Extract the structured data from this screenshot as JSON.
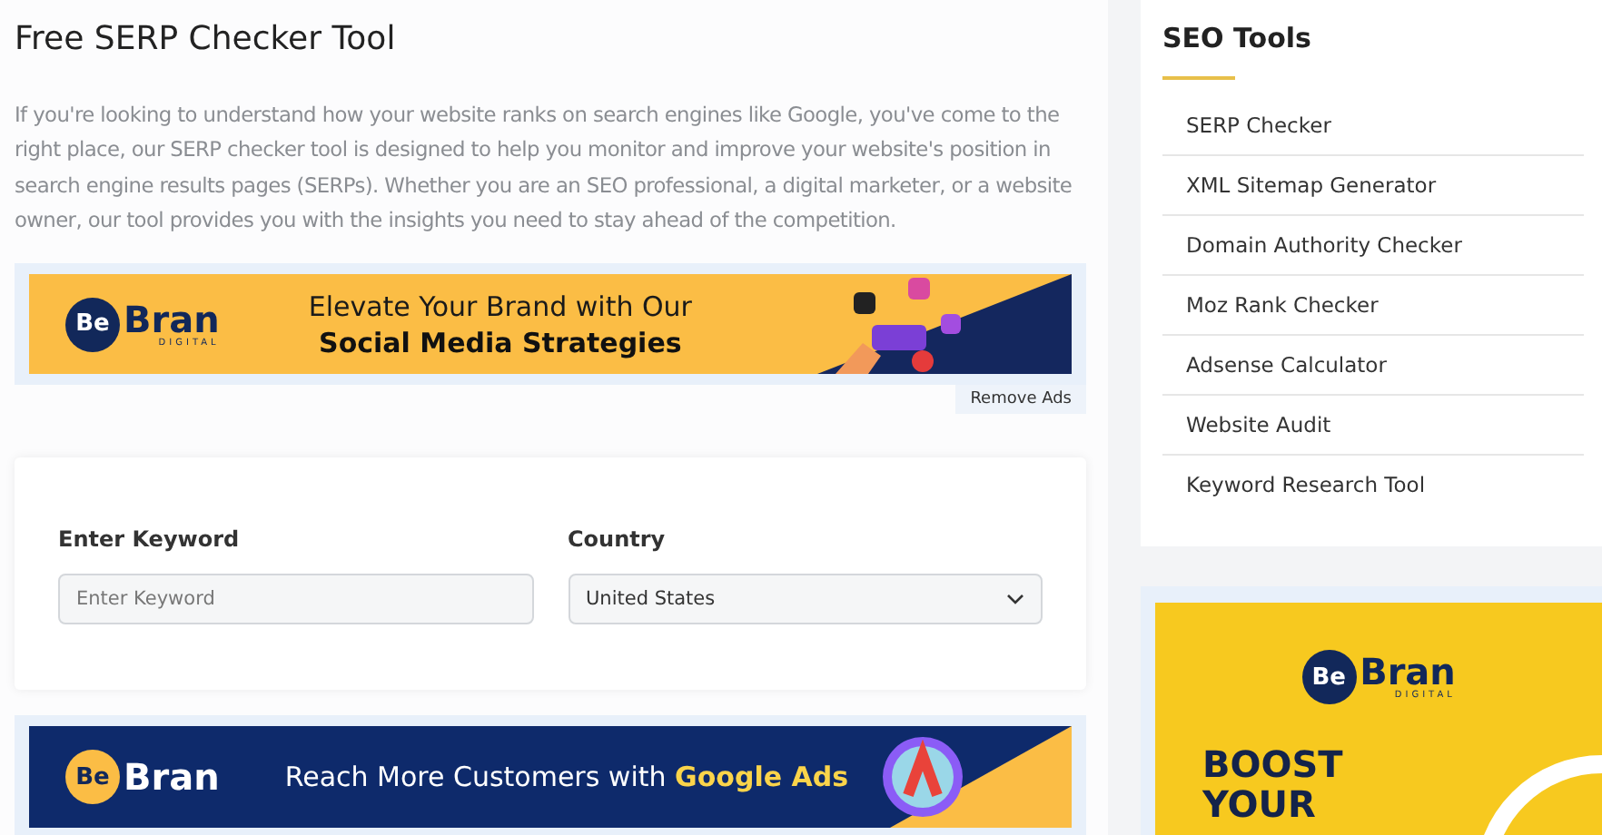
{
  "main": {
    "title": "Free SERP Checker Tool",
    "intro": "If you're looking to understand how your website ranks on search engines like Google, you've come to the right place, our SERP checker tool is designed to help you monitor and improve your website's position in search engine results pages (SERPs). Whether you are an SEO professional, a digital marketer, or a website owner, our tool provides you with the insights you need to stay ahead of the competition.",
    "banner_top": {
      "kind": "light",
      "logo_mark": "Be",
      "logo_word": "Bran",
      "logo_sub": "DIGITAL",
      "line_1": "Elevate Your Brand with Our",
      "line_2": "Social Media Strategies"
    },
    "remove_ads": "Remove Ads",
    "form": {
      "keyword_label": "Enter Keyword",
      "keyword_placeholder": "Enter Keyword",
      "country_label": "Country",
      "country_value": "United States"
    },
    "banner_bottom": {
      "kind": "dark",
      "logo_mark": "Be",
      "logo_word": "Bran",
      "text": "Reach More Customers with **Google Ads**"
    }
  },
  "sidebar": {
    "title": "SEO Tools",
    "items": [
      "SERP Checker",
      "XML Sitemap Generator",
      "Domain Authority Checker",
      "Moz Rank Checker",
      "Adsense Calculator",
      "Website Audit",
      "Keyword Research Tool"
    ]
  },
  "side_ad": {
    "logo_mark": "Be",
    "logo_word": "Bran",
    "logo_sub": "DIGITAL",
    "lines": [
      "BOOST",
      "YOUR"
    ]
  }
}
